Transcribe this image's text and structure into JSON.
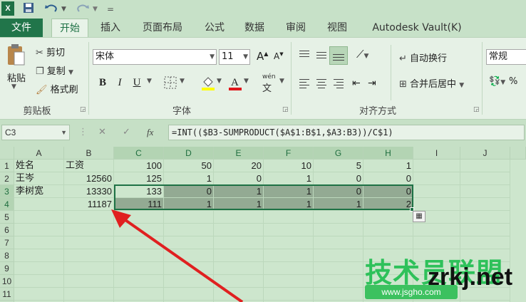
{
  "app_icon": "X",
  "quick_access": {
    "save_icon": "save-icon",
    "undo_icon": "undo-icon",
    "redo_icon": "redo-icon"
  },
  "tabs": [
    {
      "label": "文件"
    },
    {
      "label": "开始"
    },
    {
      "label": "插入"
    },
    {
      "label": "页面布局"
    },
    {
      "label": "公式"
    },
    {
      "label": "数据"
    },
    {
      "label": "审阅"
    },
    {
      "label": "视图"
    },
    {
      "label": "Autodesk Vault(K)"
    }
  ],
  "clipboard": {
    "paste": "粘贴",
    "cut": "剪切",
    "copy": "复制",
    "format_painter": "格式刷",
    "group_label": "剪贴板"
  },
  "font": {
    "name": "宋体",
    "size": "11",
    "grow": "A",
    "shrink": "A",
    "bold": "B",
    "italic": "I",
    "underline": "U",
    "phonetic": "wén",
    "group_label": "字体",
    "fill_color": "#ffff00",
    "font_color": "#e0161b"
  },
  "alignment": {
    "wrap_text": "自动换行",
    "merge_center": "合并后居中",
    "group_label": "对齐方式"
  },
  "number": {
    "format": "常规"
  },
  "formula_bar": {
    "name_box": "C3",
    "fx": "fx",
    "formula": "=INT(($B3-SUMPRODUCT($A$1:B$1,$A3:B3))/C$1)"
  },
  "sheet": {
    "columns": [
      "A",
      "B",
      "C",
      "D",
      "E",
      "F",
      "G",
      "H",
      "I",
      "J"
    ],
    "rows": [
      "1",
      "2",
      "3",
      "4",
      "5",
      "6",
      "7",
      "8",
      "9",
      "10",
      "11",
      "12"
    ],
    "cells": {
      "r1": [
        "姓名",
        "工资",
        "100",
        "50",
        "20",
        "10",
        "5",
        "1"
      ],
      "r2": [
        "王岑",
        "12560",
        "125",
        "1",
        "0",
        "1",
        "0",
        "0"
      ],
      "r3": [
        "李树宽",
        "13330",
        "133",
        "0",
        "1",
        "1",
        "0",
        "0"
      ],
      "r4": [
        "",
        "11187",
        "111",
        "1",
        "1",
        "1",
        "1",
        "2"
      ]
    }
  },
  "watermark": {
    "cn": "技术员联盟",
    "domain": "zrkj.net",
    "url": "www.jsgho.com"
  }
}
